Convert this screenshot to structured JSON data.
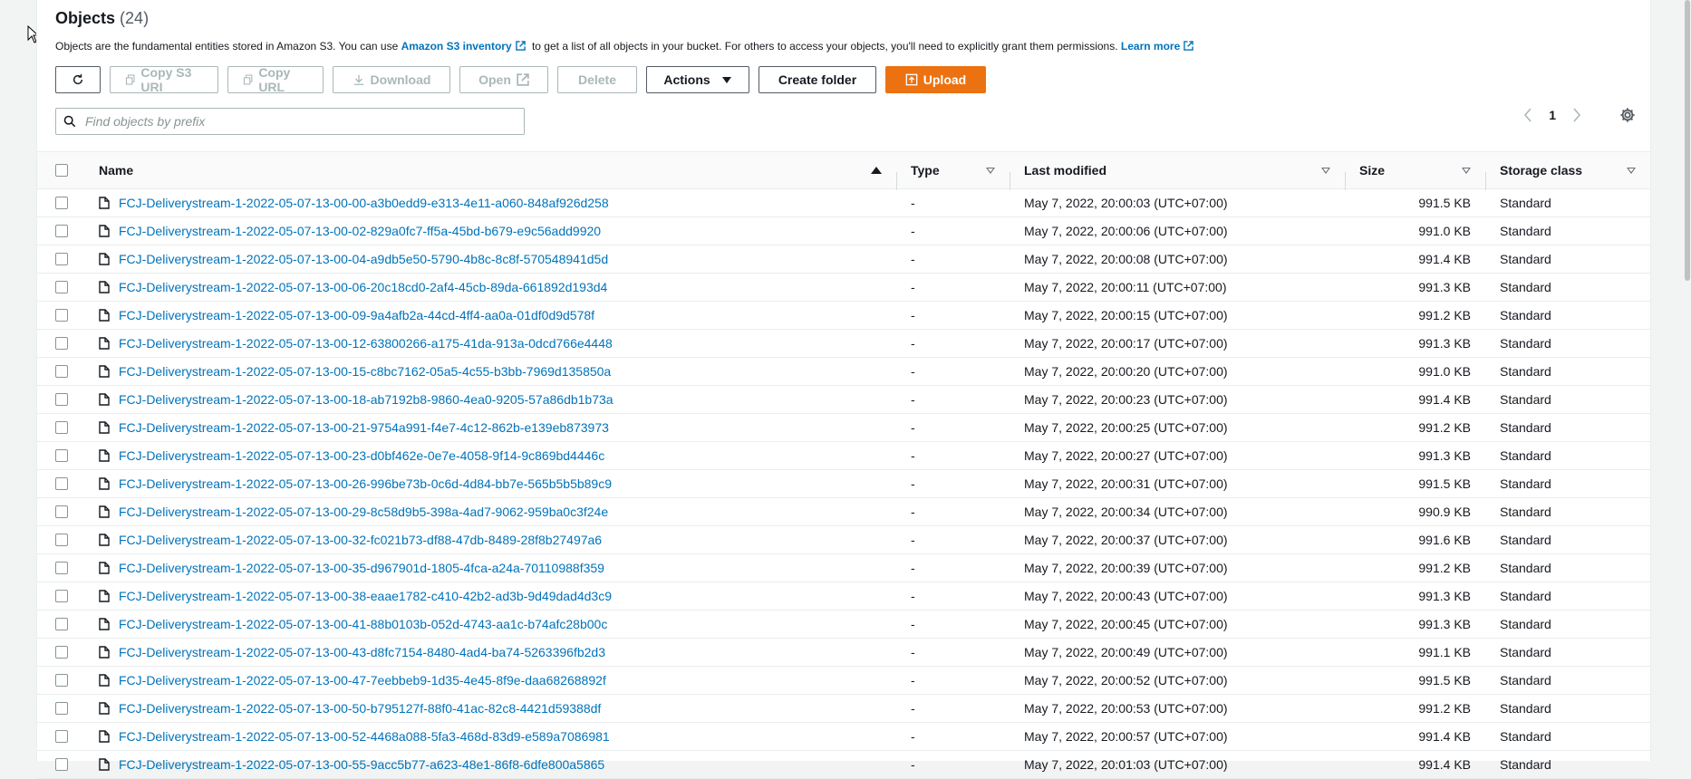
{
  "header": {
    "title": "Objects",
    "count": "(24)",
    "description_1": "Objects are the fundamental entities stored in Amazon S3. You can use",
    "inventory_link": "Amazon S3 inventory",
    "description_2": "to get a list of all objects in your bucket. For others to access your objects, you'll need to explicitly grant them permissions.",
    "learn_more": "Learn more"
  },
  "toolbar": {
    "copy_s3_uri": "Copy S3 URI",
    "copy_url": "Copy URL",
    "download": "Download",
    "open": "Open",
    "delete": "Delete",
    "actions": "Actions",
    "create_folder": "Create folder",
    "upload": "Upload"
  },
  "search": {
    "placeholder": "Find objects by prefix"
  },
  "pagination": {
    "page": "1"
  },
  "table": {
    "columns": {
      "name": "Name",
      "type": "Type",
      "last_modified": "Last modified",
      "size": "Size",
      "storage_class": "Storage class"
    },
    "rows": [
      {
        "name": "FCJ-Deliverystream-1-2022-05-07-13-00-00-a3b0edd9-e313-4e11-a060-848af926d258",
        "type": "-",
        "modified": "May 7, 2022, 20:00:03 (UTC+07:00)",
        "size": "991.5 KB",
        "class": "Standard"
      },
      {
        "name": "FCJ-Deliverystream-1-2022-05-07-13-00-02-829a0fc7-ff5a-45bd-b679-e9c56add9920",
        "type": "-",
        "modified": "May 7, 2022, 20:00:06 (UTC+07:00)",
        "size": "991.0 KB",
        "class": "Standard"
      },
      {
        "name": "FCJ-Deliverystream-1-2022-05-07-13-00-04-a9db5e50-5790-4b8c-8c8f-570548941d5d",
        "type": "-",
        "modified": "May 7, 2022, 20:00:08 (UTC+07:00)",
        "size": "991.4 KB",
        "class": "Standard"
      },
      {
        "name": "FCJ-Deliverystream-1-2022-05-07-13-00-06-20c18cd0-2af4-45cb-89da-661892d193d4",
        "type": "-",
        "modified": "May 7, 2022, 20:00:11 (UTC+07:00)",
        "size": "991.3 KB",
        "class": "Standard"
      },
      {
        "name": "FCJ-Deliverystream-1-2022-05-07-13-00-09-9a4afb2a-44cd-4ff4-aa0a-01df0d9d578f",
        "type": "-",
        "modified": "May 7, 2022, 20:00:15 (UTC+07:00)",
        "size": "991.2 KB",
        "class": "Standard"
      },
      {
        "name": "FCJ-Deliverystream-1-2022-05-07-13-00-12-63800266-a175-41da-913a-0dcd766e4448",
        "type": "-",
        "modified": "May 7, 2022, 20:00:17 (UTC+07:00)",
        "size": "991.3 KB",
        "class": "Standard"
      },
      {
        "name": "FCJ-Deliverystream-1-2022-05-07-13-00-15-c8bc7162-05a5-4c55-b3bb-7969d135850a",
        "type": "-",
        "modified": "May 7, 2022, 20:00:20 (UTC+07:00)",
        "size": "991.0 KB",
        "class": "Standard"
      },
      {
        "name": "FCJ-Deliverystream-1-2022-05-07-13-00-18-ab7192b8-9860-4ea0-9205-57a86db1b73a",
        "type": "-",
        "modified": "May 7, 2022, 20:00:23 (UTC+07:00)",
        "size": "991.4 KB",
        "class": "Standard"
      },
      {
        "name": "FCJ-Deliverystream-1-2022-05-07-13-00-21-9754a991-f4e7-4c12-862b-e139eb873973",
        "type": "-",
        "modified": "May 7, 2022, 20:00:25 (UTC+07:00)",
        "size": "991.2 KB",
        "class": "Standard"
      },
      {
        "name": "FCJ-Deliverystream-1-2022-05-07-13-00-23-d0bf462e-0e7e-4058-9f14-9c869bd4446c",
        "type": "-",
        "modified": "May 7, 2022, 20:00:27 (UTC+07:00)",
        "size": "991.3 KB",
        "class": "Standard"
      },
      {
        "name": "FCJ-Deliverystream-1-2022-05-07-13-00-26-996be73b-0c6d-4d84-bb7e-565b5b5b89c9",
        "type": "-",
        "modified": "May 7, 2022, 20:00:31 (UTC+07:00)",
        "size": "991.5 KB",
        "class": "Standard"
      },
      {
        "name": "FCJ-Deliverystream-1-2022-05-07-13-00-29-8c58d9b5-398a-4ad7-9062-959ba0c3f24e",
        "type": "-",
        "modified": "May 7, 2022, 20:00:34 (UTC+07:00)",
        "size": "990.9 KB",
        "class": "Standard"
      },
      {
        "name": "FCJ-Deliverystream-1-2022-05-07-13-00-32-fc021b73-df88-47db-8489-28f8b27497a6",
        "type": "-",
        "modified": "May 7, 2022, 20:00:37 (UTC+07:00)",
        "size": "991.6 KB",
        "class": "Standard"
      },
      {
        "name": "FCJ-Deliverystream-1-2022-05-07-13-00-35-d967901d-1805-4fca-a24a-70110988f359",
        "type": "-",
        "modified": "May 7, 2022, 20:00:39 (UTC+07:00)",
        "size": "991.2 KB",
        "class": "Standard"
      },
      {
        "name": "FCJ-Deliverystream-1-2022-05-07-13-00-38-eaae1782-c410-42b2-ad3b-9d49dad4d3c9",
        "type": "-",
        "modified": "May 7, 2022, 20:00:43 (UTC+07:00)",
        "size": "991.3 KB",
        "class": "Standard"
      },
      {
        "name": "FCJ-Deliverystream-1-2022-05-07-13-00-41-88b0103b-052d-4743-aa1c-b74afc28b00c",
        "type": "-",
        "modified": "May 7, 2022, 20:00:45 (UTC+07:00)",
        "size": "991.3 KB",
        "class": "Standard"
      },
      {
        "name": "FCJ-Deliverystream-1-2022-05-07-13-00-43-d8fc7154-8480-4ad4-ba74-5263396fb2d3",
        "type": "-",
        "modified": "May 7, 2022, 20:00:49 (UTC+07:00)",
        "size": "991.1 KB",
        "class": "Standard"
      },
      {
        "name": "FCJ-Deliverystream-1-2022-05-07-13-00-47-7eebbeb9-1d35-4e45-8f9e-daa68268892f",
        "type": "-",
        "modified": "May 7, 2022, 20:00:52 (UTC+07:00)",
        "size": "991.5 KB",
        "class": "Standard"
      },
      {
        "name": "FCJ-Deliverystream-1-2022-05-07-13-00-50-b795127f-88f0-41ac-82c8-4421d59388df",
        "type": "-",
        "modified": "May 7, 2022, 20:00:53 (UTC+07:00)",
        "size": "991.2 KB",
        "class": "Standard"
      },
      {
        "name": "FCJ-Deliverystream-1-2022-05-07-13-00-52-4468a088-5fa3-468d-83d9-e589a7086981",
        "type": "-",
        "modified": "May 7, 2022, 20:00:57 (UTC+07:00)",
        "size": "991.4 KB",
        "class": "Standard"
      },
      {
        "name": "FCJ-Deliverystream-1-2022-05-07-13-00-55-9acc5b77-a623-48e1-86f8-6dfe800a5865",
        "type": "-",
        "modified": "May 7, 2022, 20:01:03 (UTC+07:00)",
        "size": "991.4 KB",
        "class": "Standard"
      }
    ]
  },
  "colors": {
    "link": "#0073bb",
    "primary": "#ec7211",
    "disabled": "#aab7b8"
  },
  "icons": [
    "refresh-icon",
    "copy-icon",
    "download-icon",
    "external-link-icon",
    "caret-down-icon",
    "upload-icon",
    "search-icon",
    "chevron-left-icon",
    "chevron-right-icon",
    "gear-icon",
    "file-icon",
    "sort-ascending-icon",
    "filter-caret-icon"
  ]
}
